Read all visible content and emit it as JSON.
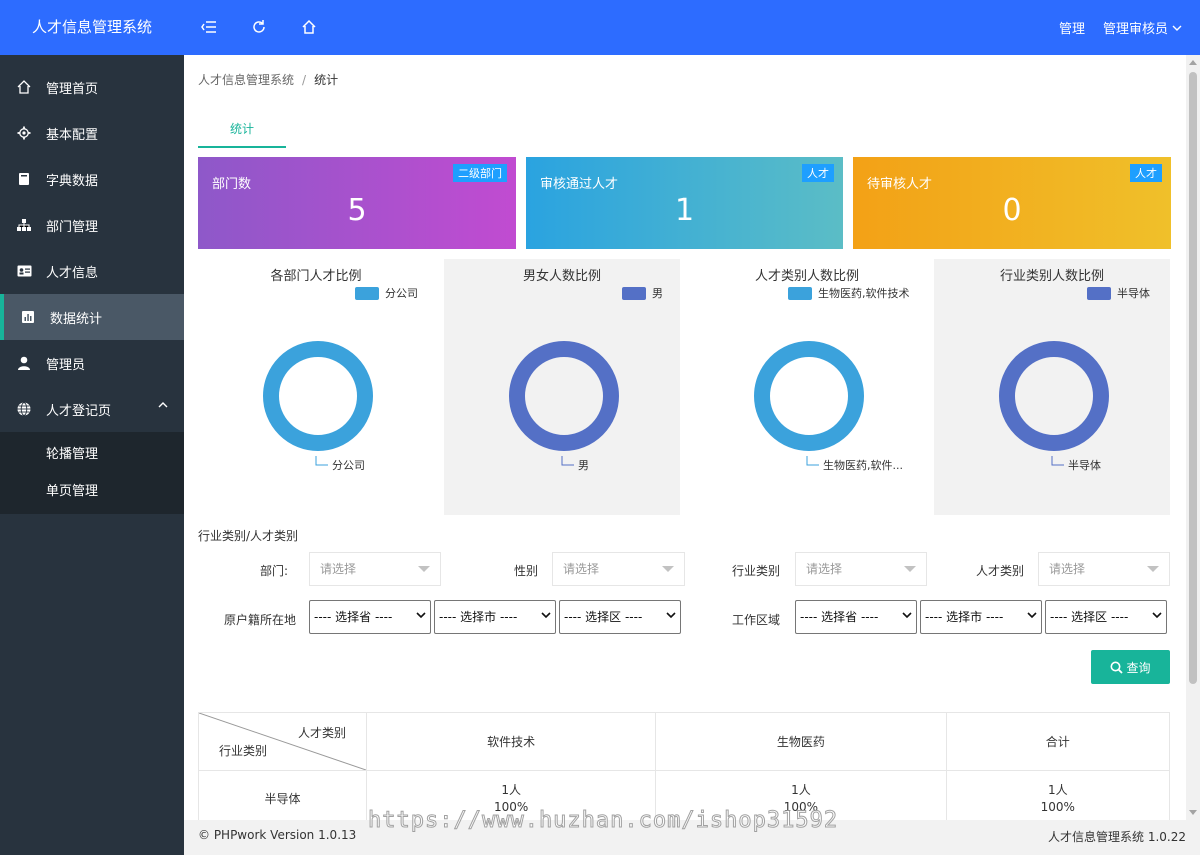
{
  "app": {
    "title": "人才信息管理系统"
  },
  "header": {
    "right": {
      "manage_label": "管理",
      "user_label": "管理审核员"
    }
  },
  "sidebar": {
    "items": [
      {
        "label": "管理首页",
        "icon": "home-icon"
      },
      {
        "label": "基本配置",
        "icon": "gear-icon"
      },
      {
        "label": "字典数据",
        "icon": "book-icon"
      },
      {
        "label": "部门管理",
        "icon": "org-chart-icon"
      },
      {
        "label": "人才信息",
        "icon": "id-card-icon"
      },
      {
        "label": "数据统计",
        "icon": "bar-chart-icon",
        "active": true
      },
      {
        "label": "管理员",
        "icon": "user-icon"
      },
      {
        "label": "人才登记页",
        "icon": "globe-icon",
        "expanded": true
      }
    ],
    "subitems": [
      {
        "label": "轮播管理"
      },
      {
        "label": "单页管理"
      }
    ]
  },
  "breadcrumb": {
    "root": "人才信息管理系统",
    "separator": "/",
    "current": "统计"
  },
  "tabs": [
    {
      "label": "统计",
      "active": true
    }
  ],
  "cards": [
    {
      "label": "部门数",
      "badge": "二级部门",
      "value": "5"
    },
    {
      "label": "审核通过人才",
      "badge": "人才",
      "value": "1"
    },
    {
      "label": "待审核人才",
      "badge": "人才",
      "value": "0"
    }
  ],
  "chart_data": [
    {
      "type": "pie",
      "title": "各部门人才比例",
      "legend": [
        "分公司"
      ],
      "slices": [
        {
          "label": "分公司",
          "value": 1,
          "display_label": "分公司"
        }
      ],
      "color": "#3ba2dc"
    },
    {
      "type": "pie",
      "title": "男女人数比例",
      "legend": [
        "男"
      ],
      "slices": [
        {
          "label": "男",
          "value": 1,
          "display_label": "男"
        }
      ],
      "color": "#5470c6"
    },
    {
      "type": "pie",
      "title": "人才类别人数比例",
      "legend": [
        "生物医药,软件技术"
      ],
      "slices": [
        {
          "label": "生物医药,软件技术",
          "value": 1,
          "display_label": "生物医药,软件..."
        }
      ],
      "color": "#3ba2dc"
    },
    {
      "type": "pie",
      "title": "行业类别人数比例",
      "legend": [
        "半导体"
      ],
      "slices": [
        {
          "label": "半导体",
          "value": 1,
          "display_label": "半导体"
        }
      ],
      "color": "#5470c6"
    }
  ],
  "filters": {
    "title": "行业类别/人才类别",
    "department": {
      "label": "部门:",
      "placeholder": "请选择"
    },
    "gender": {
      "label": "性别",
      "placeholder": "请选择"
    },
    "industry": {
      "label": "行业类别",
      "placeholder": "请选择"
    },
    "talent_type": {
      "label": "人才类别",
      "placeholder": "请选择"
    },
    "origin": {
      "label": "原户籍所在地",
      "province": "---- 选择省 ----",
      "city": "---- 选择市 ----",
      "district": "---- 选择区 ----"
    },
    "work_area": {
      "label": "工作区域",
      "province": "---- 选择省 ----",
      "city": "---- 选择市 ----",
      "district": "---- 选择区 ----"
    },
    "query_label": "查询"
  },
  "table": {
    "corner_top": "人才类别",
    "corner_bottom": "行业类别",
    "columns": [
      "软件技术",
      "生物医药",
      "合计"
    ],
    "rows": [
      {
        "label": "半导体",
        "cells": [
          {
            "count": "1人",
            "percent": "100%"
          },
          {
            "count": "1人",
            "percent": "100%"
          },
          {
            "count": "1人",
            "percent": "100%"
          }
        ]
      }
    ]
  },
  "footer": {
    "left": "© PHPwork Version 1.0.13",
    "right": "人才信息管理系统 1.0.22"
  },
  "watermark": "https://www.huzhan.com/ishop31592"
}
